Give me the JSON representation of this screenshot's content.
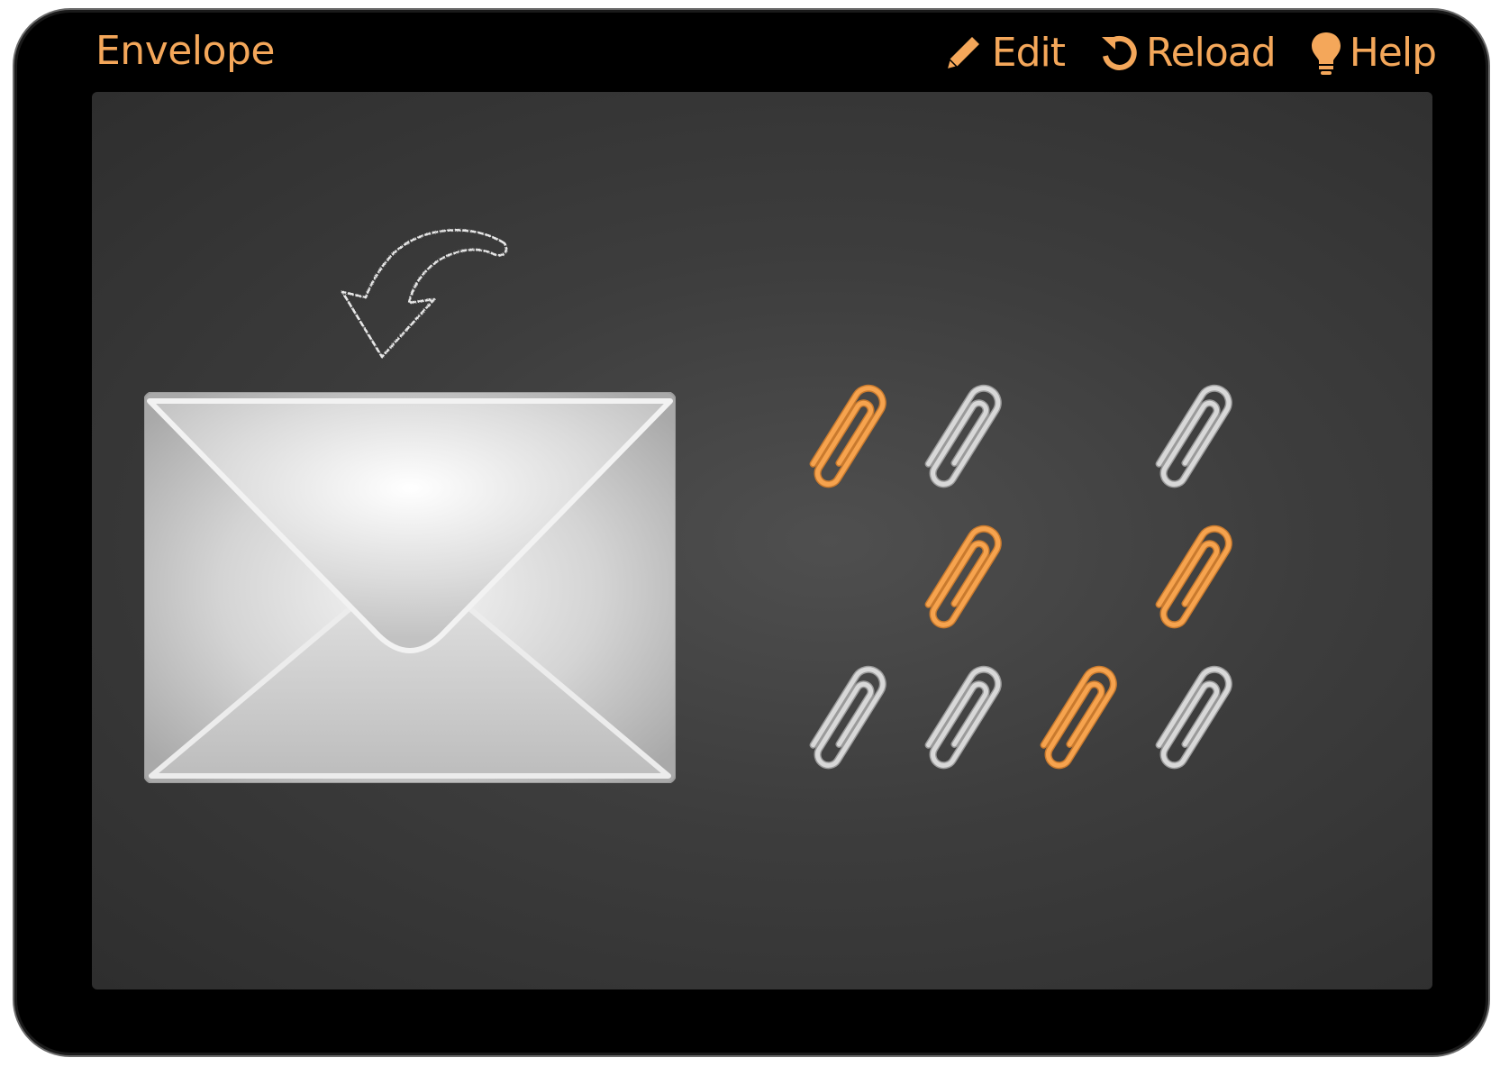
{
  "app": {
    "title": "Envelope"
  },
  "toolbar": {
    "edit_label": "Edit",
    "reload_label": "Reload",
    "help_label": "Help",
    "edit_icon": "pencil-icon",
    "reload_icon": "reload-icon",
    "help_icon": "lightbulb-icon"
  },
  "colors": {
    "accent": "#f4a75a",
    "device": "#000000",
    "board": "#3d3d3d",
    "clip_orange": "#f6a34e",
    "clip_silver": "#d8d8d8"
  },
  "scene": {
    "envelope_icon": "envelope-icon",
    "arrow_icon": "curved-arrow-icon",
    "clip_grid_columns": 4,
    "clip_grid_rows": 3,
    "clips": [
      {
        "row": 1,
        "col": 1,
        "color": "orange"
      },
      {
        "row": 1,
        "col": 2,
        "color": "silver"
      },
      {
        "row": 1,
        "col": 4,
        "color": "silver"
      },
      {
        "row": 2,
        "col": 2,
        "color": "orange"
      },
      {
        "row": 2,
        "col": 4,
        "color": "orange"
      },
      {
        "row": 3,
        "col": 1,
        "color": "silver"
      },
      {
        "row": 3,
        "col": 2,
        "color": "silver"
      },
      {
        "row": 3,
        "col": 3,
        "color": "orange"
      },
      {
        "row": 3,
        "col": 4,
        "color": "silver"
      }
    ]
  }
}
